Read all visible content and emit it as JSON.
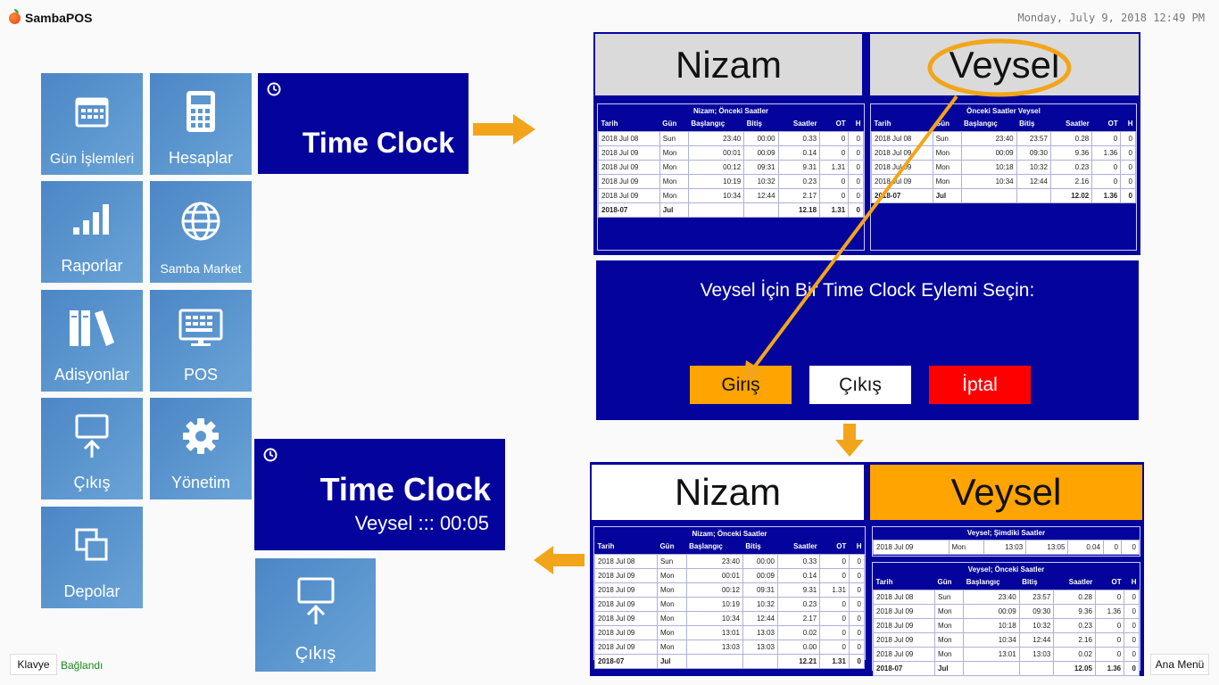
{
  "app": {
    "name": "SambaPOS",
    "datetime": "Monday, July 9, 2018 12:49 PM"
  },
  "tiles": [
    {
      "label": "Gün İşlemleri",
      "icon": "calendar-icon"
    },
    {
      "label": "Hesaplar",
      "icon": "calculator-icon"
    },
    {
      "label": "Raporlar",
      "icon": "bar-chart-icon"
    },
    {
      "label": "Samba Market",
      "icon": "globe-icon"
    },
    {
      "label": "Adisyonlar",
      "icon": "books-icon"
    },
    {
      "label": "POS",
      "icon": "monitor-icon"
    },
    {
      "label": "Çıkış",
      "icon": "logout-icon"
    },
    {
      "label": "Yönetim",
      "icon": "gear-icon"
    },
    {
      "label": "Depolar",
      "icon": "copy-icon"
    }
  ],
  "timeclock_top": {
    "title": "Time Clock"
  },
  "timeclock_bottom": {
    "title": "Time Clock",
    "subtitle": "Veysel ::: 00:05"
  },
  "exit_tile": {
    "label": "Çıkış"
  },
  "upper_panel": {
    "nizam": "Nizam",
    "veysel": "Veysel",
    "headers": [
      "Tarih",
      "Gün",
      "Başlangıç",
      "Bitiş",
      "Saatler",
      "OT",
      "H"
    ],
    "nizam_caption": "Nizam; Önceki Saatler",
    "nizam_rows": [
      [
        "2018 Jul 08",
        "Sun",
        "23:40",
        "00:00",
        "0.33",
        "0",
        "0"
      ],
      [
        "2018 Jul 09",
        "Mon",
        "00:01",
        "00:09",
        "0.14",
        "0",
        "0"
      ],
      [
        "2018 Jul 09",
        "Mon",
        "00:12",
        "09:31",
        "9.31",
        "1.31",
        "0"
      ],
      [
        "2018 Jul 09",
        "Mon",
        "10:19",
        "10:32",
        "0.23",
        "0",
        "0"
      ],
      [
        "2018 Jul 09",
        "Mon",
        "10:34",
        "12:44",
        "2.17",
        "0",
        "0"
      ]
    ],
    "nizam_total": [
      "2018-07",
      "Jul",
      "",
      "",
      "12.18",
      "1.31",
      "0"
    ],
    "veysel_caption": "Önceki Saatler Veysel",
    "veysel_rows": [
      [
        "2018 Jul 08",
        "Sun",
        "23:40",
        "23:57",
        "0.28",
        "0",
        "0"
      ],
      [
        "2018 Jul 09",
        "Mon",
        "00:09",
        "09:30",
        "9.36",
        "1.36",
        "0"
      ],
      [
        "2018 Jul 09",
        "Mon",
        "10:18",
        "10:32",
        "0.23",
        "0",
        "0"
      ],
      [
        "2018 Jul 09",
        "Mon",
        "10:34",
        "12:44",
        "2.16",
        "0",
        "0"
      ]
    ],
    "veysel_total": [
      "2018-07",
      "Jul",
      "",
      "",
      "12.02",
      "1.36",
      "0"
    ]
  },
  "action_panel": {
    "prompt": "Veysel İçin Bir Time Clock Eylemi Seçin:",
    "btn_in": "Giriş",
    "btn_out": "Çıkış",
    "btn_cancel": "İptal"
  },
  "lower_panel": {
    "nizam": "Nizam",
    "veysel": "Veysel",
    "headers": [
      "Tarih",
      "Gün",
      "Başlangıç",
      "Bitiş",
      "Saatler",
      "OT",
      "H"
    ],
    "nizam_caption": "Nizam; Önceki Saatler",
    "nizam_rows": [
      [
        "2018 Jul 08",
        "Sun",
        "23:40",
        "00:00",
        "0.33",
        "0",
        "0"
      ],
      [
        "2018 Jul 09",
        "Mon",
        "00:01",
        "00:09",
        "0.14",
        "0",
        "0"
      ],
      [
        "2018 Jul 09",
        "Mon",
        "00:12",
        "09:31",
        "9.31",
        "1.31",
        "0"
      ],
      [
        "2018 Jul 09",
        "Mon",
        "10:19",
        "10:32",
        "0.23",
        "0",
        "0"
      ],
      [
        "2018 Jul 09",
        "Mon",
        "10:34",
        "12:44",
        "2.17",
        "0",
        "0"
      ],
      [
        "2018 Jul 09",
        "Mon",
        "13:01",
        "13:03",
        "0.02",
        "0",
        "0"
      ],
      [
        "2018 Jul 09",
        "Mon",
        "13:03",
        "13:03",
        "0.00",
        "0",
        "0"
      ]
    ],
    "nizam_total": [
      "2018-07",
      "Jul",
      "",
      "",
      "12.21",
      "1.31",
      "0"
    ],
    "veysel_now_caption": "Veysel; Şimdiki Saatler",
    "veysel_now_rows": [
      [
        "2018 Jul 09",
        "Mon",
        "13:03",
        "13:05",
        "0.04",
        "0",
        "0"
      ]
    ],
    "veysel_caption": "Veysel; Önceki Saatler",
    "veysel_rows": [
      [
        "2018 Jul 08",
        "Sun",
        "23:40",
        "23:57",
        "0.28",
        "0",
        "0"
      ],
      [
        "2018 Jul 09",
        "Mon",
        "00:09",
        "09:30",
        "9.36",
        "1.36",
        "0"
      ],
      [
        "2018 Jul 09",
        "Mon",
        "10:18",
        "10:32",
        "0.23",
        "0",
        "0"
      ],
      [
        "2018 Jul 09",
        "Mon",
        "10:34",
        "12:44",
        "2.16",
        "0",
        "0"
      ],
      [
        "2018 Jul 09",
        "Mon",
        "13:01",
        "13:03",
        "0.02",
        "0",
        "0"
      ]
    ],
    "veysel_total": [
      "2018-07",
      "Jul",
      "",
      "",
      "12.05",
      "1.36",
      "0"
    ]
  },
  "status": {
    "keyboard": "Klavye",
    "connection": "Bağlandı",
    "main_menu": "Ana Menü"
  },
  "colors": {
    "navy": "#04049c",
    "tile": "#5b96cf",
    "orange": "#ffa400",
    "red": "#ff0000",
    "arrow": "#f2a51a",
    "connected": "#1a8a1a"
  }
}
